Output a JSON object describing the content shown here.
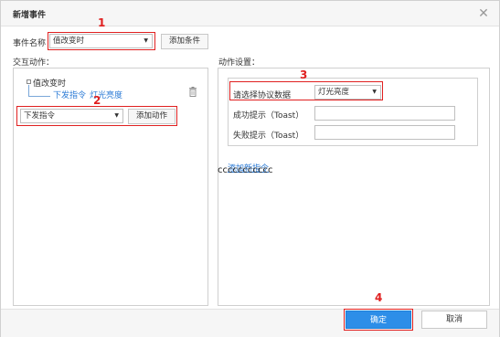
{
  "dialog": {
    "title": "新增事件",
    "close_glyph": "✕"
  },
  "event": {
    "name_label": "事件名称",
    "name_selected": "值改变时",
    "add_condition": "添加条件"
  },
  "interaction": {
    "section_label": "交互动作：",
    "tree": {
      "root": "值改变时",
      "child_action": "下发指令",
      "child_target": "灯光亮度"
    },
    "action_select": "下发指令",
    "add_action": "添加动作"
  },
  "settings": {
    "section_label": "动作设置：",
    "protocol_label": "请选择协议数据",
    "protocol_selected": "灯光亮度",
    "success_label": "成功提示（Toast）",
    "success_value": "",
    "fail_label": "失败提示（Toast）",
    "fail_value": "",
    "add_instruction": "添加新指令",
    "overlay_text": "ccccccccccc"
  },
  "footer": {
    "ok": "确定",
    "cancel": "取消"
  },
  "markers": {
    "m1": "1",
    "m2": "2",
    "m3": "3",
    "m4": "4"
  },
  "colors": {
    "highlight": "#e02020",
    "primary": "#2d8ee8",
    "link": "#2a7ad5"
  },
  "icons": {
    "close": "close-icon",
    "caret": "chevron-down-icon",
    "trash": "trash-icon"
  }
}
